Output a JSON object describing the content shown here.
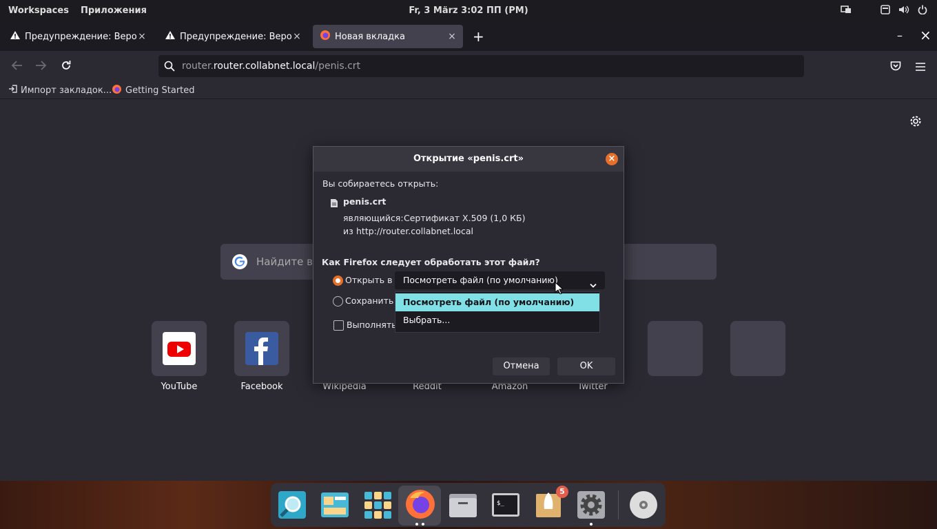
{
  "topbar": {
    "workspaces": "Workspaces",
    "apps": "Приложения",
    "clock": "Fr, 3 März   3:02 ПП (PM)"
  },
  "tabs": [
    {
      "title": "Предупреждение: Вероятн"
    },
    {
      "title": "Предупреждение: Вероятн"
    },
    {
      "title": "Новая вкладка"
    }
  ],
  "new_tab": "+",
  "window": {
    "minimize": "–",
    "close": "×"
  },
  "urlbar": {
    "host": "router.collabnet.local",
    "path": "/penis.crt"
  },
  "bookmarks": [
    {
      "label": "Импорт закладок..."
    },
    {
      "label": "Getting Started"
    }
  ],
  "newtab": {
    "search_placeholder": "Найдите в G",
    "tiles": [
      {
        "label": "YouTube"
      },
      {
        "label": "Facebook"
      },
      {
        "label": "Wikipedia"
      },
      {
        "label": "Reddit"
      },
      {
        "label": "Amazon"
      },
      {
        "label": "Twitter"
      }
    ]
  },
  "dialog": {
    "title": "Открытие «penis.crt»",
    "intro": "Вы собираетесь открыть:",
    "filename": "penis.crt",
    "type_label": "являющийся:",
    "type_value": "Сертификат X.509 (1,0 КБ)",
    "from_label": "из",
    "from_value": "http://router.collabnet.local",
    "question": "Как Firefox следует обработать этот файл?",
    "open_in": "Открыть в",
    "save": "Сохранить с",
    "do_this": "Выполнять",
    "select_value": "Посмотреть файл (по умолчанию)",
    "options": [
      "Посмотреть файл (по умолчанию)",
      "Выбрать..."
    ],
    "cancel": "Отмена",
    "ok": "OK"
  },
  "dock": {
    "badge": "5"
  },
  "colors": {
    "accent": "#e66f2b",
    "selected_option": "#80e0e6"
  }
}
